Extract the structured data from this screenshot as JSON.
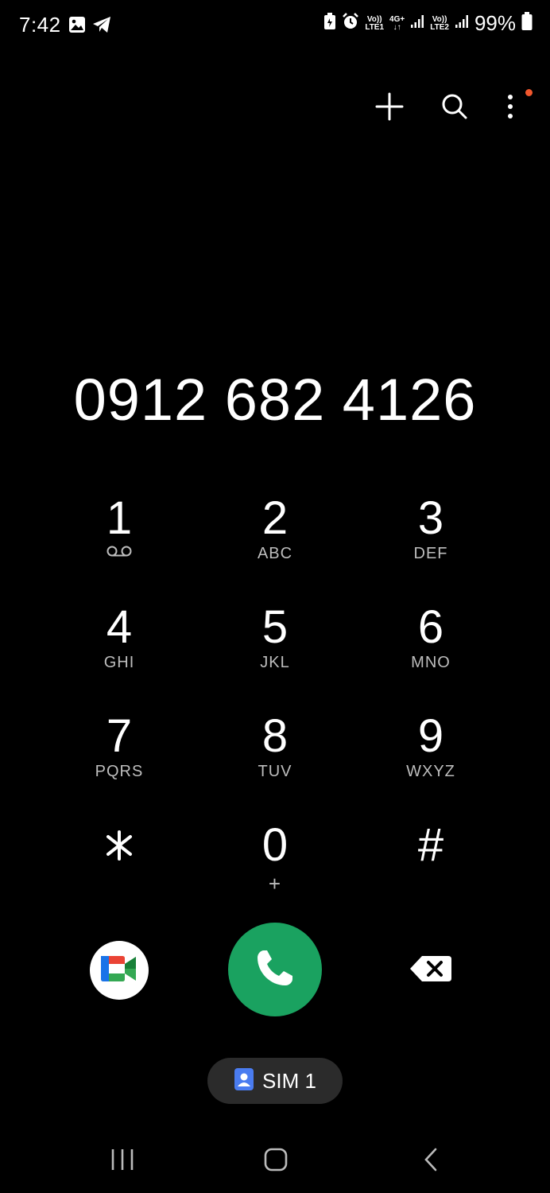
{
  "status_bar": {
    "time": "7:42",
    "left_icons": [
      "image-icon",
      "telegram-icon"
    ],
    "right_icons": [
      "battery-saver-icon",
      "alarm-icon"
    ],
    "sim1_net": {
      "line1": "Vo))",
      "line2": "LTE1"
    },
    "data_net": {
      "line1": "4G+",
      "line2": "↓↑"
    },
    "sim2_net": {
      "line1": "Vo))",
      "line2": "LTE2"
    },
    "battery": "99%"
  },
  "top_actions": {
    "add_icon": "plus-icon",
    "search_icon": "search-icon",
    "menu_icon": "more-vertical-icon",
    "notification_dot_color": "#f2572d"
  },
  "dialed_number": "0912 682 4126",
  "keypad": [
    {
      "digit": "1",
      "letters": "",
      "sub_icon": "voicemail-icon"
    },
    {
      "digit": "2",
      "letters": "ABC"
    },
    {
      "digit": "3",
      "letters": "DEF"
    },
    {
      "digit": "4",
      "letters": "GHI"
    },
    {
      "digit": "5",
      "letters": "JKL"
    },
    {
      "digit": "6",
      "letters": "MNO"
    },
    {
      "digit": "7",
      "letters": "PQRS"
    },
    {
      "digit": "8",
      "letters": "TUV"
    },
    {
      "digit": "9",
      "letters": "WXYZ"
    },
    {
      "digit": "⁎",
      "letters": ""
    },
    {
      "digit": "0",
      "letters": "+"
    },
    {
      "digit": "#",
      "letters": ""
    }
  ],
  "call_row": {
    "video_app_icon": "google-meet-icon",
    "call_icon": "phone-icon",
    "call_color": "#1aa260",
    "backspace_icon": "backspace-icon"
  },
  "sim_selector": {
    "label": "SIM 1",
    "icon": "contact-card-icon",
    "icon_color": "#4a7cf0"
  },
  "nav_bar": {
    "recents_icon": "recents-icon",
    "home_icon": "home-icon",
    "back_icon": "back-icon"
  }
}
